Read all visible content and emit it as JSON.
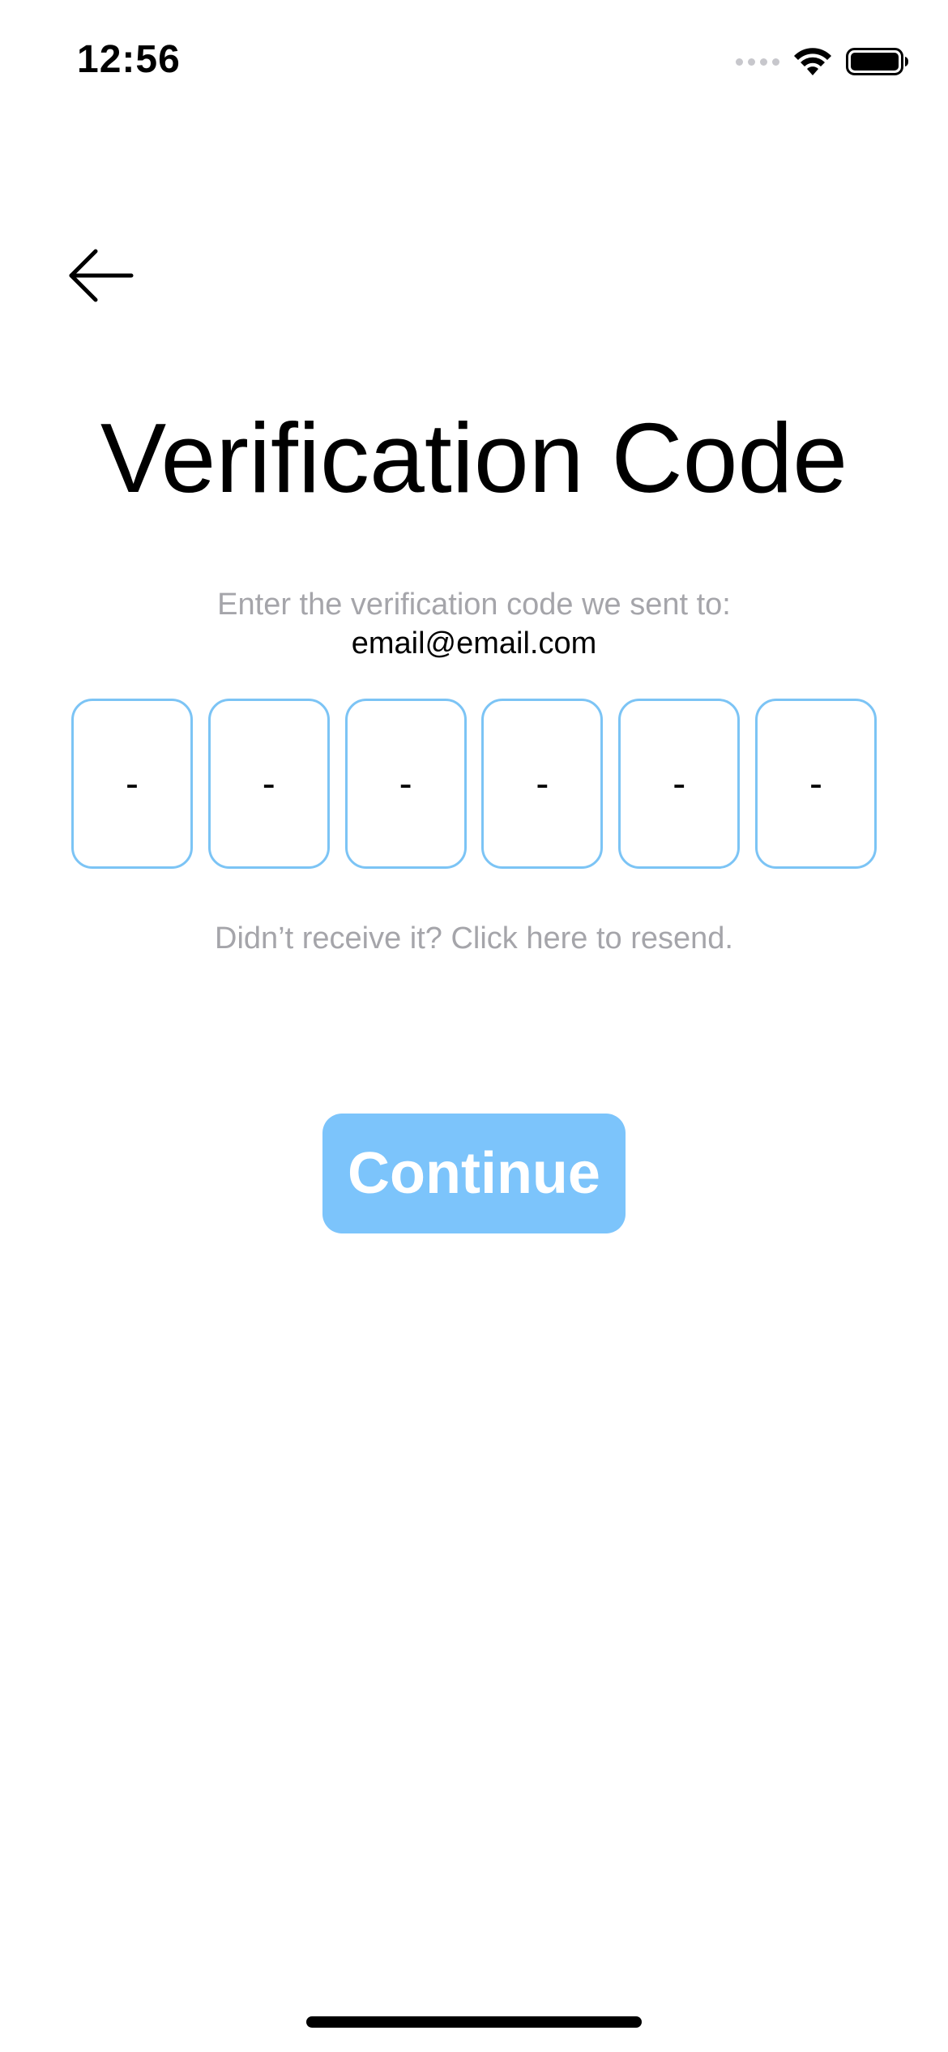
{
  "status_bar": {
    "time": "12:56",
    "icons": [
      "cellular-signal-icon",
      "wifi-icon",
      "battery-icon"
    ]
  },
  "navigation": {
    "back_icon": "arrow-left-icon"
  },
  "title": "Verification Code",
  "instruction": "Enter the verification code we sent to:",
  "email": "email@email.com",
  "code_inputs": [
    "-",
    "-",
    "-",
    "-",
    "-",
    "-"
  ],
  "resend_text": "Didn’t receive it? Click here to resend.",
  "continue_label": "Continue",
  "colors": {
    "accent": "#7cc4fb",
    "input_border": "#7cc4f5",
    "muted_text": "#a5a5aa"
  }
}
